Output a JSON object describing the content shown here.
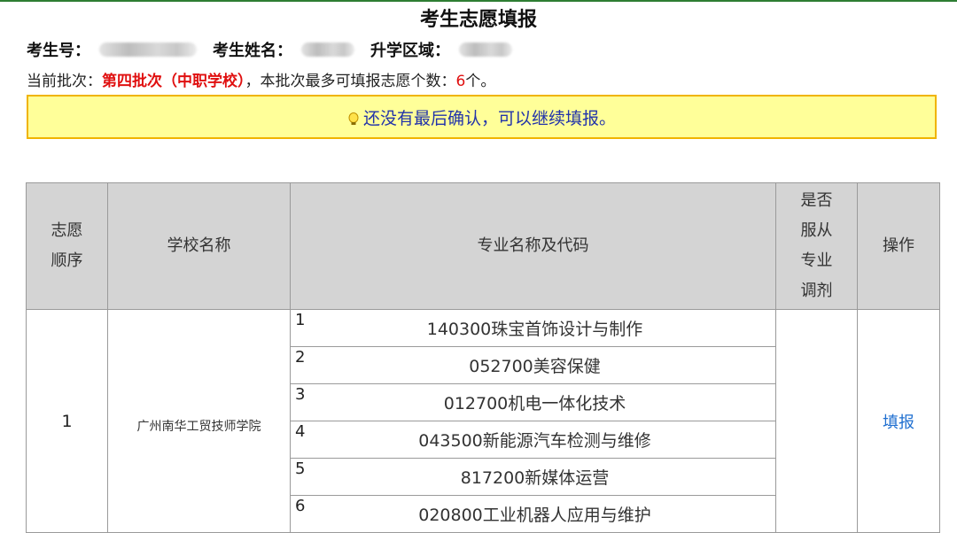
{
  "page": {
    "title": "考生志愿填报"
  },
  "info": {
    "exam_no_label": "考生号：",
    "name_label": "考生姓名：",
    "region_label": "升学区域："
  },
  "batch": {
    "prefix": "当前批次：",
    "name": "第四批次（中职学校）",
    "middle": "，本批次最多可填报志愿个数：",
    "max_count": "6",
    "suffix": "个。"
  },
  "notice": {
    "icon": "lightbulb-icon",
    "text": "还没有最后确认，可以继续填报。"
  },
  "table": {
    "headers": {
      "order": "志愿顺序",
      "school": "学校名称",
      "major": "专业名称及代码",
      "adjust": "是否服从专业调剂",
      "action": "操作"
    },
    "rows": [
      {
        "order": "1",
        "school": "广州南华工贸技师学院",
        "adjust": "",
        "action": "填报",
        "majors": [
          {
            "num": "1",
            "name": "140300珠宝首饰设计与制作"
          },
          {
            "num": "2",
            "name": "052700美容保健"
          },
          {
            "num": "3",
            "name": "012700机电一体化技术"
          },
          {
            "num": "4",
            "name": "043500新能源汽车检测与维修"
          },
          {
            "num": "5",
            "name": "817200新媒体运营"
          },
          {
            "num": "6",
            "name": "020800工业机器人应用与维护"
          }
        ]
      }
    ]
  },
  "colors": {
    "accent_red": "#e01010",
    "notice_bg": "#ffff99",
    "notice_border": "#f0b400",
    "link_blue": "#1f6fd0",
    "header_gray": "#d4d4d4"
  }
}
